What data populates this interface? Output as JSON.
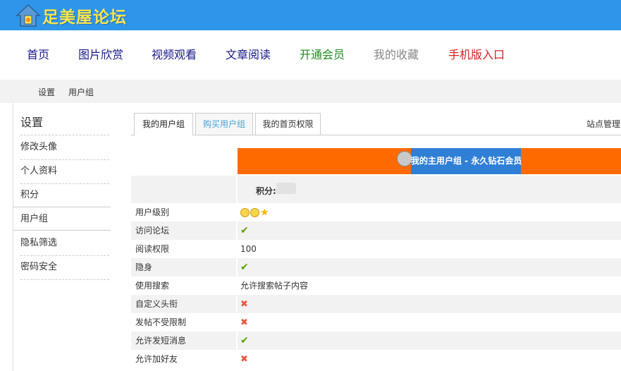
{
  "header": {
    "logo_text": "足美屋论坛",
    "colors": {
      "bar": "#2e96ea",
      "logo_text": "#ffe44a"
    }
  },
  "nav": {
    "items": [
      {
        "label": "首页",
        "color": "#1a1a8c"
      },
      {
        "label": "图片欣赏",
        "color": "#1a1a8c"
      },
      {
        "label": "视频观看",
        "color": "#1a1a8c"
      },
      {
        "label": "文章阅读",
        "color": "#1a1a8c"
      },
      {
        "label": "开通会员",
        "color": "#1e8a1e"
      },
      {
        "label": "我的收藏",
        "color": "#888888"
      },
      {
        "label": "手机版入口",
        "color": "#d42020"
      }
    ]
  },
  "breadcrumb": {
    "items": [
      "设置",
      "用户组"
    ]
  },
  "sidebar": {
    "title": "设置",
    "items": [
      "修改头像",
      "个人资料",
      "积分",
      "用户组",
      "隐私筛选",
      "密码安全"
    ],
    "active": "用户组"
  },
  "tabs": [
    "我的用户组",
    "购买用户组",
    "我的首页权限"
  ],
  "site_management": "站点管理",
  "banner": {
    "text": "我的主用户组 - 永久钻石会员"
  },
  "credit": {
    "label": "积分:"
  },
  "permissions": [
    {
      "label": "用户级别",
      "value": "",
      "icon": "level-icons"
    },
    {
      "label": "访问论坛",
      "value": "",
      "icon": "check"
    },
    {
      "label": "阅读权限",
      "value": "100",
      "icon": ""
    },
    {
      "label": "隐身",
      "value": "",
      "icon": "check"
    },
    {
      "label": "使用搜索",
      "value": "允许搜索帖子内容",
      "icon": ""
    },
    {
      "label": "自定义头衔",
      "value": "",
      "icon": "cross"
    },
    {
      "label": "发帖不受限制",
      "value": "",
      "icon": "cross"
    },
    {
      "label": "允许发短消息",
      "value": "",
      "icon": "check"
    },
    {
      "label": "允许加好友",
      "value": "",
      "icon": "cross"
    }
  ]
}
